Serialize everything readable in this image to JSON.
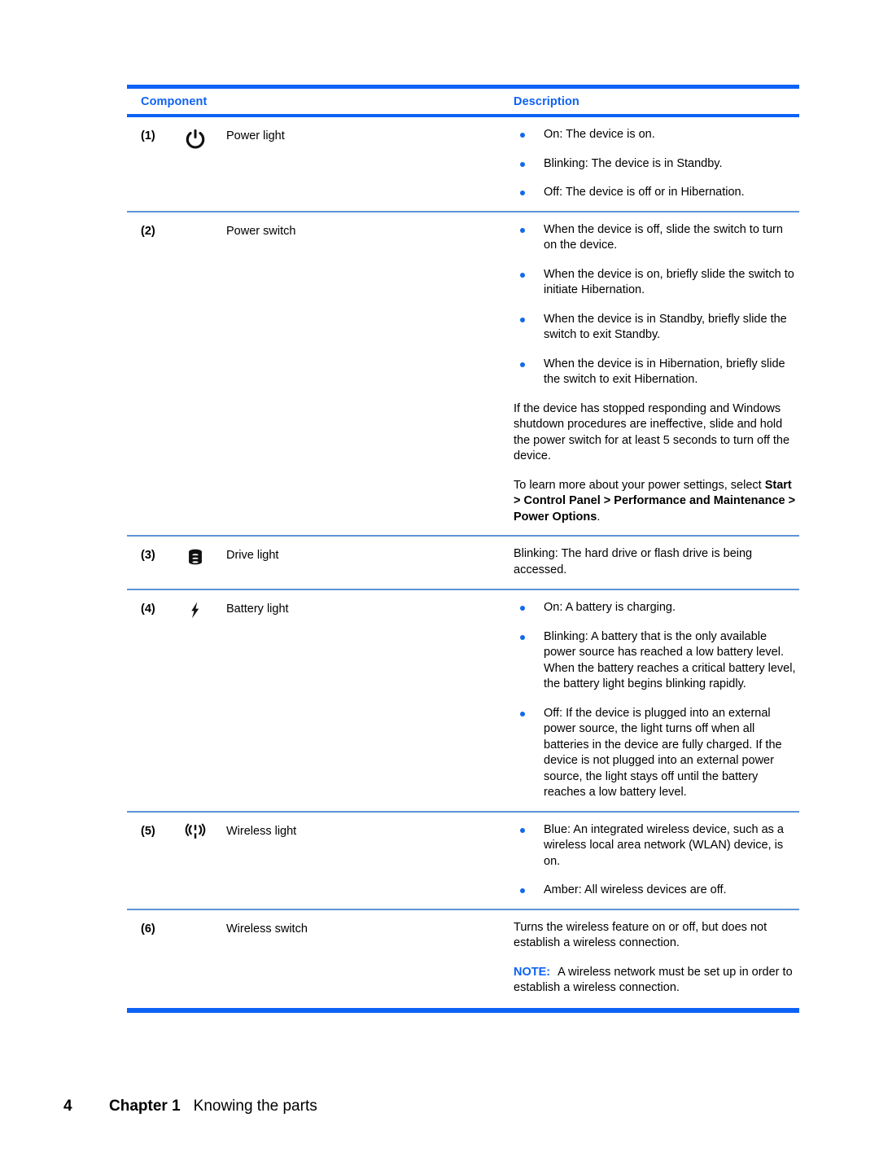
{
  "document": {
    "table": {
      "headers": {
        "component": "Component",
        "description": "Description"
      },
      "accent_color": "#0d62f5",
      "rule_color": "#5f94d8",
      "rows": [
        {
          "number": "(1)",
          "icon": "power-icon",
          "label": "Power light",
          "bullets": [
            "On: The device is on.",
            "Blinking: The device is in Standby.",
            "Off: The device is off or in Hibernation."
          ],
          "paragraphs": []
        },
        {
          "number": "(2)",
          "icon": null,
          "label": "Power switch",
          "bullets": [
            "When the device is off, slide the switch to turn on the device.",
            "When the device is on, briefly slide the switch to initiate Hibernation.",
            "When the device is in Standby, briefly slide the switch to exit Standby.",
            "When the device is in Hibernation, briefly slide the switch to exit Hibernation."
          ],
          "paragraphs": [
            "If the device has stopped responding and Windows shutdown procedures are ineffective, slide and hold the power switch for at least 5 seconds to turn off the device.",
            "To learn more about your power settings, select "
          ],
          "bold_path": "Start > Control Panel > Performance and Maintenance > Power Options",
          "bold_suffix": "."
        },
        {
          "number": "(3)",
          "icon": "hard-drive-icon",
          "label": "Drive light",
          "bullets": [],
          "paragraphs": [
            "Blinking: The hard drive or flash drive is being accessed."
          ]
        },
        {
          "number": "(4)",
          "icon": "lightning-bolt-icon",
          "label": "Battery light",
          "bullets": [
            "On: A battery is charging.",
            "Blinking: A battery that is the only available power source has reached a low battery level. When the battery reaches a critical battery level, the battery light begins blinking rapidly.",
            "Off: If the device is plugged into an external power source, the light turns off when all batteries in the device are fully charged. If the device is not plugged into an external power source, the light stays off until the battery reaches a low battery level."
          ],
          "paragraphs": []
        },
        {
          "number": "(5)",
          "icon": "wireless-icon",
          "label": "Wireless light",
          "bullets": [
            "Blue: An integrated wireless device, such as a wireless local area network (WLAN) device, is on.",
            "Amber: All wireless devices are off."
          ],
          "paragraphs": []
        },
        {
          "number": "(6)",
          "icon": null,
          "label": "Wireless switch",
          "bullets": [],
          "paragraphs": [
            "Turns the wireless feature on or off, but does not establish a wireless connection."
          ],
          "note_label": "NOTE:",
          "note_text": "A wireless network must be set up in order to establish a wireless connection."
        }
      ]
    }
  },
  "footer": {
    "page_number": "4",
    "chapter": "Chapter 1",
    "title": "Knowing the parts"
  }
}
